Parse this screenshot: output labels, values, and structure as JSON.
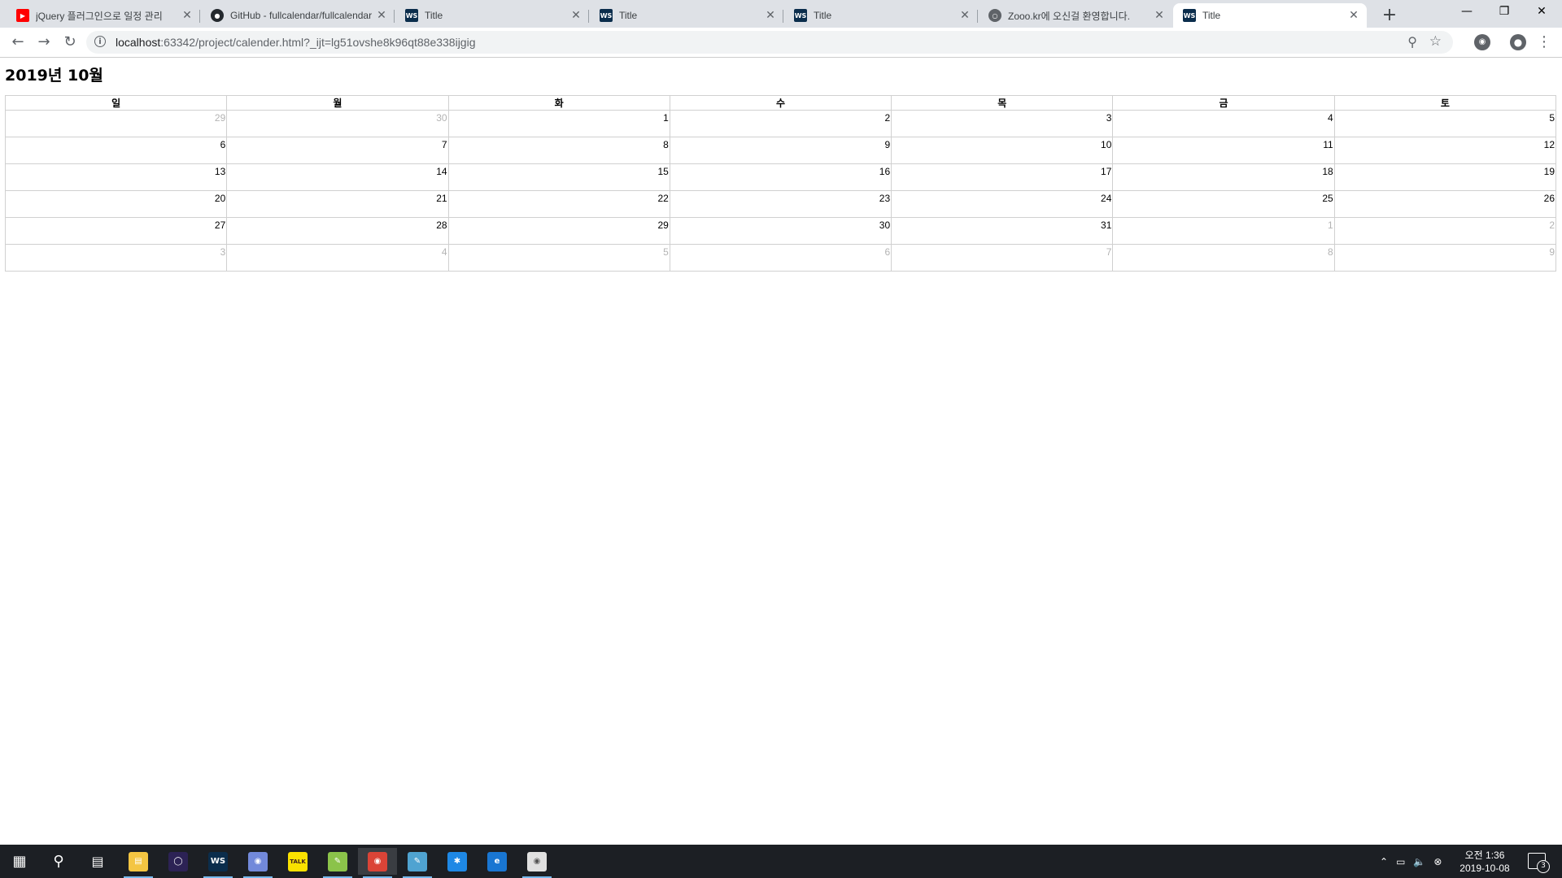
{
  "browser": {
    "tabs": [
      {
        "title": "jQuery 플러그인으로 일정 관리",
        "favicon": "youtube-icon"
      },
      {
        "title": "GitHub - fullcalendar/fullcalendar",
        "favicon": "github-icon"
      },
      {
        "title": "Title",
        "favicon": "webstorm-icon"
      },
      {
        "title": "Title",
        "favicon": "webstorm-icon"
      },
      {
        "title": "Title",
        "favicon": "webstorm-icon"
      },
      {
        "title": "Zooo.kr에 오신걸 환영합니다.",
        "favicon": "globe-icon"
      },
      {
        "title": "Title",
        "favicon": "webstorm-icon",
        "active": true
      }
    ],
    "url_host": "localhost",
    "url_rest": ":63342/project/calender.html?_ijt=lg51ovshe8k96qt88e338ijgig"
  },
  "calendar": {
    "title": "2019년 10월",
    "weekdays": [
      "일",
      "월",
      "화",
      "수",
      "목",
      "금",
      "토"
    ],
    "weeks": [
      [
        {
          "d": "29",
          "o": true
        },
        {
          "d": "30",
          "o": true
        },
        {
          "d": "1"
        },
        {
          "d": "2"
        },
        {
          "d": "3"
        },
        {
          "d": "4"
        },
        {
          "d": "5"
        }
      ],
      [
        {
          "d": "6"
        },
        {
          "d": "7"
        },
        {
          "d": "8"
        },
        {
          "d": "9"
        },
        {
          "d": "10"
        },
        {
          "d": "11"
        },
        {
          "d": "12"
        }
      ],
      [
        {
          "d": "13"
        },
        {
          "d": "14"
        },
        {
          "d": "15"
        },
        {
          "d": "16"
        },
        {
          "d": "17"
        },
        {
          "d": "18"
        },
        {
          "d": "19"
        }
      ],
      [
        {
          "d": "20"
        },
        {
          "d": "21"
        },
        {
          "d": "22"
        },
        {
          "d": "23"
        },
        {
          "d": "24"
        },
        {
          "d": "25"
        },
        {
          "d": "26"
        }
      ],
      [
        {
          "d": "27"
        },
        {
          "d": "28"
        },
        {
          "d": "29"
        },
        {
          "d": "30"
        },
        {
          "d": "31"
        },
        {
          "d": "1",
          "o": true
        },
        {
          "d": "2",
          "o": true
        }
      ],
      [
        {
          "d": "3",
          "o": true
        },
        {
          "d": "4",
          "o": true
        },
        {
          "d": "5",
          "o": true
        },
        {
          "d": "6",
          "o": true
        },
        {
          "d": "7",
          "o": true
        },
        {
          "d": "8",
          "o": true
        },
        {
          "d": "9",
          "o": true
        }
      ]
    ]
  },
  "taskbar": {
    "apps": [
      "file-explorer-icon",
      "eclipse-icon",
      "webstorm-icon",
      "discord-icon",
      "kakaotalk-icon",
      "notepad-icon",
      "chrome-icon",
      "notepad2-icon",
      "bluetooth-app-icon",
      "edge-icon",
      "paint-icon"
    ],
    "clock_time": "오전 1:36",
    "clock_date": "2019-10-08",
    "notification_count": "3"
  },
  "colors": {
    "tabstrip": "#dee1e6",
    "taskbar": "#1c1f24",
    "other_month_text": "#b3b3b3"
  }
}
